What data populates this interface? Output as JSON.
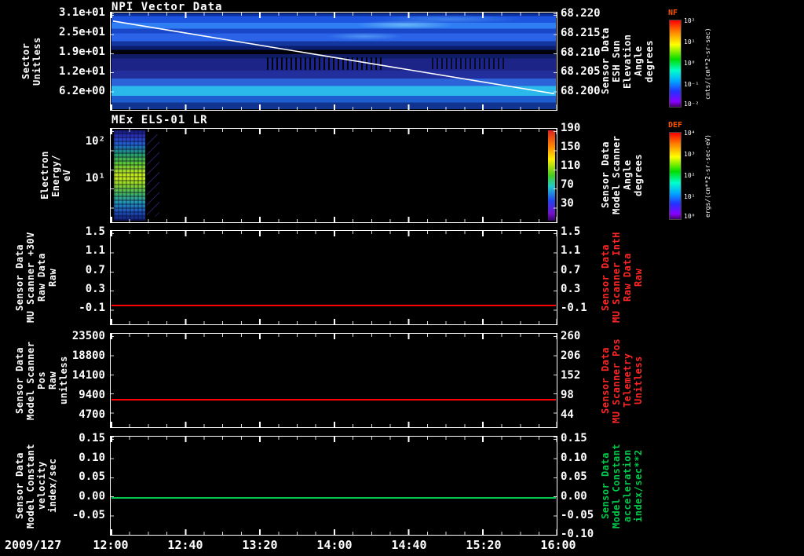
{
  "date_label": "2009/127",
  "xticks": [
    "12:00",
    "12:40",
    "13:20",
    "14:00",
    "14:40",
    "15:20",
    "16:00"
  ],
  "panel1": {
    "title": "NPI Vector Data",
    "left_label": "Sector\nUnitless",
    "yticks_left": [
      "3.1e+01",
      "2.5e+01",
      "1.9e+01",
      "1.2e+01",
      "6.2e+00"
    ],
    "yticks_right": [
      "68.220",
      "68.215",
      "68.210",
      "68.205",
      "68.200"
    ],
    "right_label": "Sensor Data\nESH Sun Elevation\nAngle\ndegrees",
    "colorbar": {
      "name": "NF",
      "units": "cnts/(cm**2-sr-sec)",
      "ticks": [
        "10²",
        "10¹",
        "10⁰",
        "10⁻¹",
        "10⁻²"
      ]
    }
  },
  "panel2": {
    "title": "MEx ELS-01 LR",
    "left_label": "Electron Energy/\neV",
    "yticks_left": [
      "10²",
      "10¹"
    ],
    "yticks_right": [
      "190",
      "150",
      "110",
      "70",
      "30"
    ],
    "right_label": "Sensor Data\nModel Scanner\nAngle\ndegrees",
    "colorbar": {
      "name": "DEF",
      "units": "ergs/(cm**2-sr-sec-eV)",
      "ticks": [
        "10⁴",
        "10³",
        "10²",
        "10¹",
        "10⁰"
      ]
    }
  },
  "panel3": {
    "left_label": "Sensor Data\nMU Scanner +30V\nRaw Data\nRaw",
    "yticks_left": [
      "1.5",
      "1.1",
      "0.7",
      "0.3",
      "-0.1"
    ],
    "yticks_right": [
      "1.5",
      "1.1",
      "0.7",
      "0.3",
      "-0.1"
    ],
    "right_label": "Sensor Data\nMU Scanner IntH\nRaw Data\nRaw"
  },
  "panel4": {
    "left_label": "Sensor Data\nModel Scanner Pos\nRaw\nunitless",
    "yticks_left": [
      "23500",
      "18800",
      "14100",
      "9400",
      "4700"
    ],
    "yticks_right": [
      "260",
      "206",
      "152",
      "98",
      "44"
    ],
    "right_label": "Sensor Data\nMU Scanner Pos\nTelemetry\nUnitless"
  },
  "panel5": {
    "left_label": "Sensor Data\nModel Constant\nvelocity\nindex/sec",
    "yticks_left": [
      "0.15",
      "0.10",
      "0.05",
      "0.00",
      "-0.05"
    ],
    "yticks_right": [
      "0.15",
      "0.10",
      "0.05",
      "0.00",
      "-0.05",
      "-0.10"
    ],
    "right_label": "Sensor Data\nModel Constant\nacceleration\nindex/sec**2"
  },
  "colors": {
    "line_red": "#ff0000",
    "line_green": "#00c84a",
    "axis_white": "#ffffff",
    "colorbar_label": "#ff5500"
  },
  "chart_data": [
    {
      "type": "heatmap",
      "title": "NPI Vector Data",
      "xlabel": "time 2009/127 12:00-16:00",
      "x_ticks": [
        "12:00",
        "12:40",
        "13:20",
        "14:00",
        "14:40",
        "15:20",
        "16:00"
      ],
      "ylabel": "Sector Unitless",
      "yticks": [
        31,
        25,
        19,
        12,
        6.2
      ],
      "right_axis": {
        "label": "Sensor Data ESH Sun Elevation Angle degrees",
        "ticks": [
          68.22,
          68.215,
          68.21,
          68.205,
          68.2
        ]
      },
      "colorbar": {
        "label": "NF",
        "units": "cnts/(cm**2-sr-sec)",
        "scale": "log"
      },
      "overlay_line": {
        "color": "#ffffff",
        "description": "sun elevation angle decreasing linearly from ~68.219 at 12:00 to ~68.200 at 16:00"
      },
      "features": [
        "horizontal blue banded count-rate structure across all sectors",
        "black band near sector ~15",
        "bright cyan band near sector ~8",
        "speckled black dropouts in low sectors between ~13:20 and ~15:40",
        "brighter cyan patches near top between ~14:00 and ~15:00"
      ]
    },
    {
      "type": "heatmap",
      "title": "MEx ELS-01 LR",
      "ylabel": "Electron Energy/ eV",
      "yscale": "log",
      "yticks": [
        10,
        100
      ],
      "right_axis": {
        "label": "Sensor Data Model Scanner Angle degrees",
        "ticks": [
          190,
          150,
          110,
          70,
          30
        ]
      },
      "colorbar": {
        "label": "DEF",
        "units": "ergs/(cm**2-sr-sec-eV)",
        "scale": "log"
      },
      "features": [
        "broad energy spectrum present only ~12:05-12:20, peak flux green-yellow at 10-50 eV",
        "data gap from ~12:20 to ~15:55",
        "narrow rainbow strip (red top to violet bottom) at right edge near 16:00"
      ]
    },
    {
      "type": "line",
      "series": [
        {
          "name": "MU Scanner +30V Raw Data Raw",
          "color": "#ff0000",
          "constant_value": 0.0
        }
      ],
      "ylim": [
        -0.1,
        1.5
      ],
      "yticks": [
        1.5,
        1.1,
        0.7,
        0.3,
        -0.1
      ],
      "right_yticks": [
        1.5,
        1.1,
        0.7,
        0.3,
        -0.1
      ]
    },
    {
      "type": "line",
      "series": [
        {
          "name": "Model Scanner Pos Raw unitless",
          "color": "#ff0000",
          "constant_value": 9700
        }
      ],
      "yticks": [
        23500,
        18800,
        14100,
        9400,
        4700
      ],
      "right_yticks": [
        260,
        206,
        152,
        98,
        44
      ],
      "right_constant_value": 100
    },
    {
      "type": "line",
      "series": [
        {
          "name": "Model Constant velocity index/sec",
          "color": "#00c84a",
          "constant_value": 0.0
        }
      ],
      "ylim": [
        -0.1,
        0.15
      ],
      "yticks": [
        0.15,
        0.1,
        0.05,
        0.0,
        -0.05
      ],
      "right_yticks": [
        0.15,
        0.1,
        0.05,
        0.0,
        -0.05,
        -0.1
      ]
    }
  ]
}
